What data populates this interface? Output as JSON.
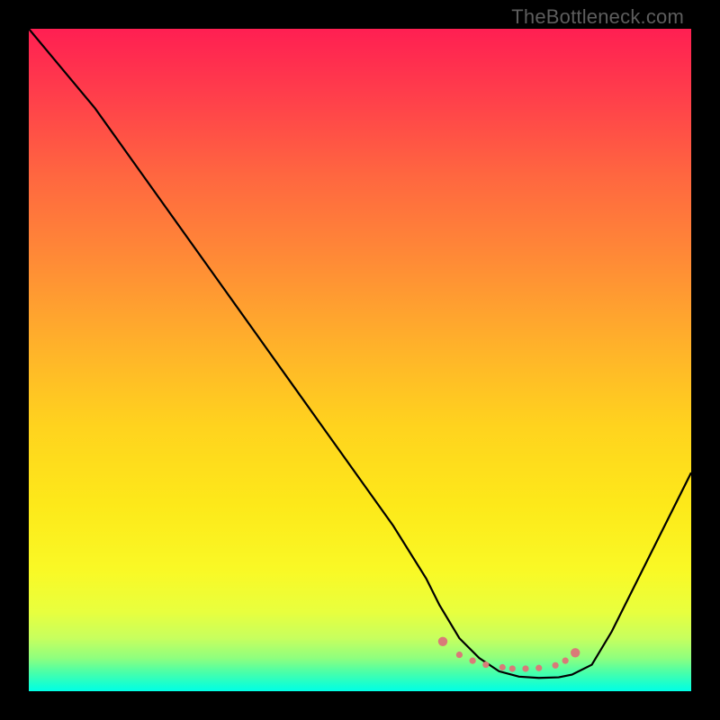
{
  "watermark": {
    "text": "TheBottleneck.com"
  },
  "chart_data": {
    "type": "line",
    "title": "",
    "xlabel": "",
    "ylabel": "",
    "xlim": [
      0,
      100
    ],
    "ylim": [
      0,
      100
    ],
    "grid": false,
    "background": "red-yellow-green vertical gradient (high=red, low=green)",
    "series": [
      {
        "name": "bottleneck-curve",
        "x": [
          0,
          5,
          10,
          15,
          20,
          25,
          30,
          35,
          40,
          45,
          50,
          55,
          60,
          62,
          65,
          68,
          71,
          74,
          77,
          80,
          82,
          85,
          88,
          92,
          96,
          100
        ],
        "y": [
          100,
          94,
          88,
          81,
          74,
          67,
          60,
          53,
          46,
          39,
          32,
          25,
          17,
          13,
          8,
          5,
          3,
          2.2,
          2,
          2.1,
          2.5,
          4,
          9,
          17,
          25,
          33
        ]
      }
    ],
    "annotations": [
      {
        "name": "optimal-range-markers",
        "type": "scatter",
        "color": "#d97a78",
        "x": [
          62.5,
          65.0,
          67.0,
          69.0,
          71.5,
          73.0,
          75.0,
          77.0,
          79.5,
          81.0,
          82.5
        ],
        "y": [
          7.5,
          5.5,
          4.6,
          4.0,
          3.6,
          3.4,
          3.4,
          3.5,
          3.9,
          4.6,
          5.8
        ]
      }
    ]
  }
}
